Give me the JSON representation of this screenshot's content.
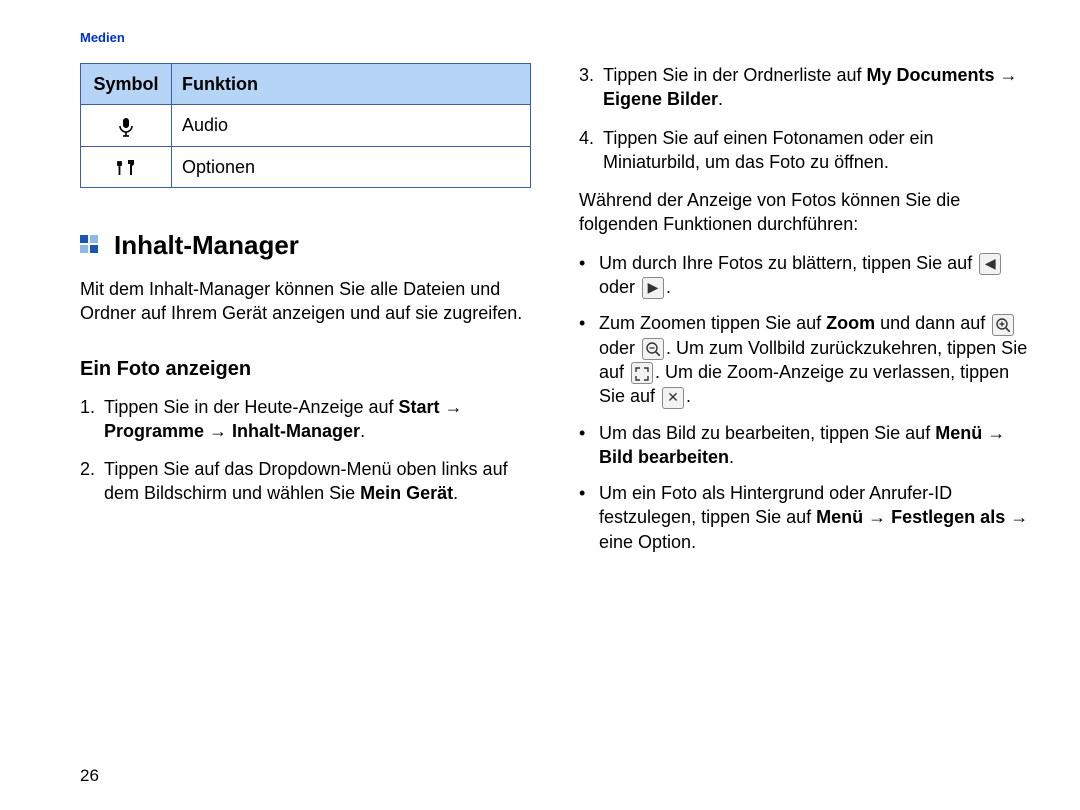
{
  "header": {
    "section": "Medien"
  },
  "table": {
    "headers": [
      "Symbol",
      "Funktion"
    ],
    "rows": [
      {
        "icon": "mic-icon",
        "label": "Audio"
      },
      {
        "icon": "tools-icon",
        "label": "Optionen"
      }
    ]
  },
  "title": "Inhalt-Manager",
  "intro": "Mit dem Inhalt-Manager können Sie alle Dateien und Ordner auf Ihrem Gerät anzeigen und auf sie zugreifen.",
  "subheading": "Ein Foto anzeigen",
  "steps_left": [
    {
      "n": "1.",
      "pre": "Tippen Sie in der Heute-Anzeige auf ",
      "bold": "Start → Programme → Inhalt-Manager",
      "post": "."
    },
    {
      "n": "2.",
      "pre": "Tippen Sie auf das Dropdown-Menü oben links auf dem Bildschirm und wählen Sie ",
      "bold": "Mein Gerät",
      "post": "."
    }
  ],
  "steps_right": [
    {
      "n": "3.",
      "pre": "Tippen Sie in der Ordnerliste auf ",
      "bold": "My Documents → Eigene Bilder",
      "post": "."
    },
    {
      "n": "4.",
      "pre": "Tippen Sie auf einen Fotonamen oder ein Miniaturbild, um das Foto zu öffnen.",
      "bold": "",
      "post": ""
    }
  ],
  "mid_paragraph": "Während der Anzeige von Fotos können Sie die folgenden Funktionen durchführen:",
  "bullets": {
    "b1": {
      "pre": "Um durch Ihre Fotos zu blättern, tippen Sie auf ",
      "mid": " oder ",
      "post": "."
    },
    "b2": {
      "pre": "Zum Zoomen tippen Sie auf ",
      "zoom": "Zoom",
      "and": " und dann auf ",
      "or": " oder ",
      "full1": ". Um zum Vollbild zurückzukehren, tippen Sie auf ",
      "full2": ". Um die Zoom-Anzeige zu verlassen, tippen Sie auf ",
      "end": "."
    },
    "b3": {
      "pre": "Um das Bild zu bearbeiten, tippen Sie auf ",
      "bold": "Menü → Bild bearbeiten",
      "post": "."
    },
    "b4": {
      "pre": "Um ein Foto als Hintergrund oder Anrufer-ID festzulegen, tippen Sie auf ",
      "bold": "Menü → Festlegen als →",
      "post": " eine Option."
    }
  },
  "page_number": "26"
}
